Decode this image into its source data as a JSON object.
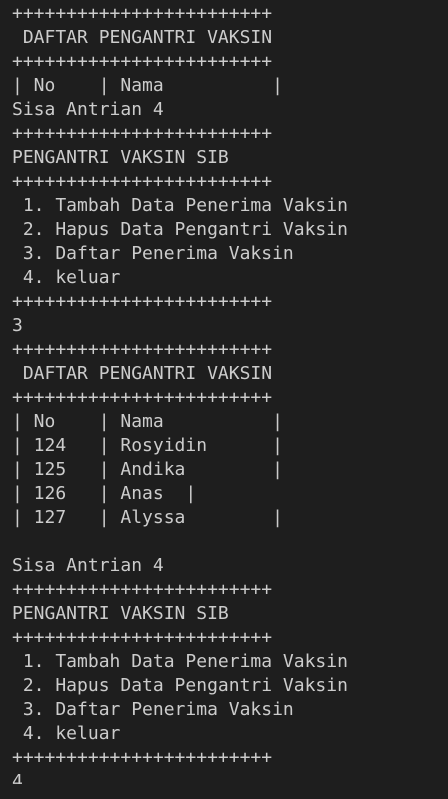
{
  "terminal": {
    "lines": [
      "++++++++++++++++++++++++",
      " DAFTAR PENGANTRI VAKSIN",
      "++++++++++++++++++++++++",
      "| No    | Nama          |",
      "Sisa Antrian 4",
      "++++++++++++++++++++++++",
      "PENGANTRI VAKSIN SIB",
      "++++++++++++++++++++++++",
      " 1. Tambah Data Penerima Vaksin",
      " 2. Hapus Data Pengantri Vaksin",
      " 3. Daftar Penerima Vaksin",
      " 4. keluar",
      "++++++++++++++++++++++++",
      "3",
      "++++++++++++++++++++++++",
      " DAFTAR PENGANTRI VAKSIN",
      "++++++++++++++++++++++++",
      "| No    | Nama          |",
      "| 124   | Rosyidin      |",
      "| 125   | Andika        |",
      "| 126   | Anas  |",
      "| 127   | Alyssa        |",
      "",
      "Sisa Antrian 4",
      "++++++++++++++++++++++++",
      "PENGANTRI VAKSIN SIB",
      "++++++++++++++++++++++++",
      " 1. Tambah Data Penerima Vaksin",
      " 2. Hapus Data Pengantri Vaksin",
      " 3. Daftar Penerima Vaksin",
      " 4. keluar",
      "++++++++++++++++++++++++",
      "4"
    ]
  }
}
